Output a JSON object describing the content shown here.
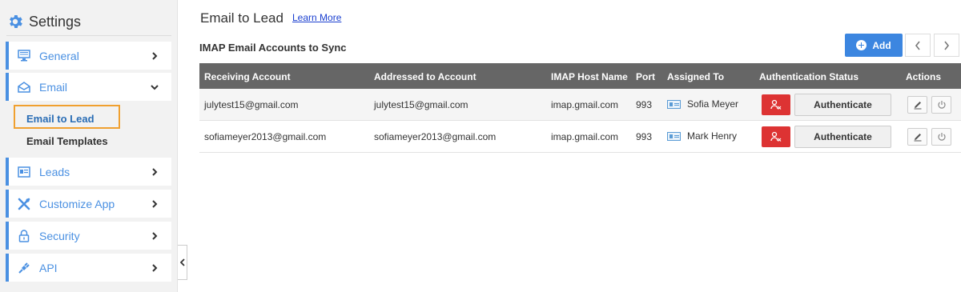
{
  "sidebar": {
    "title": "Settings",
    "items": [
      {
        "label": "General",
        "icon": "monitor-icon"
      },
      {
        "label": "Email",
        "icon": "envelope-icon"
      },
      {
        "label": "Leads",
        "icon": "leads-card-icon"
      },
      {
        "label": "Customize App",
        "icon": "tools-icon"
      },
      {
        "label": "Security",
        "icon": "lock-icon"
      },
      {
        "label": "API",
        "icon": "plug-icon"
      }
    ],
    "email_subitems": [
      "Email to Lead",
      "Email Templates"
    ]
  },
  "main": {
    "title": "Email to Lead",
    "learn_more": "Learn More",
    "section_title": "IMAP Email Accounts to Sync",
    "add_label": "Add",
    "table": {
      "headers": [
        "Receiving Account",
        "Addressed to Account",
        "IMAP Host Name",
        "Port",
        "Assigned To",
        "Authentication Status",
        "Actions"
      ],
      "rows": [
        {
          "receiving": "julytest15@gmail.com",
          "addressed": "julytest15@gmail.com",
          "host": "imap.gmail.com",
          "port": "993",
          "assigned": "Sofia Meyer",
          "auth_label": "Authenticate"
        },
        {
          "receiving": "sofiameyer2013@gmail.com",
          "addressed": "sofiameyer2013@gmail.com",
          "host": "imap.gmail.com",
          "port": "993",
          "assigned": "Mark Henry",
          "auth_label": "Authenticate"
        }
      ]
    }
  },
  "colors": {
    "accent": "#4a90e2",
    "add_button": "#3c86e0",
    "table_header": "#666666",
    "revoke_button": "#dd3333",
    "active_highlight": "#f0a030"
  }
}
